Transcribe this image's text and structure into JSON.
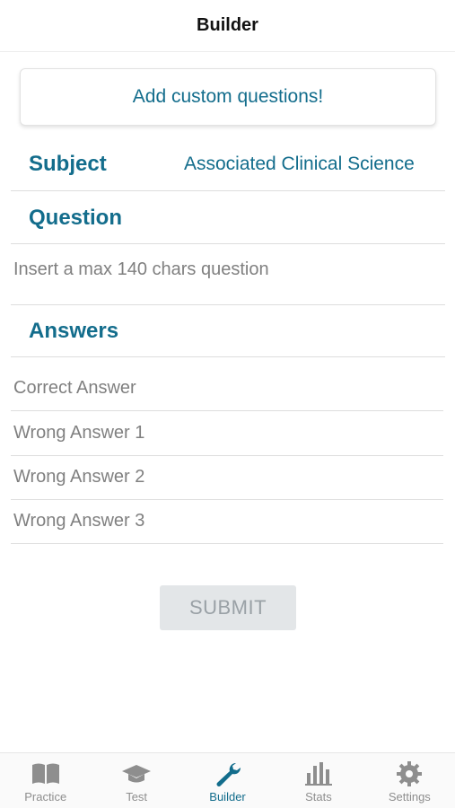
{
  "header": {
    "title": "Builder"
  },
  "custom_button": {
    "label": "Add custom questions!"
  },
  "subject": {
    "label": "Subject",
    "value": "Associated Clinical Science"
  },
  "question": {
    "label": "Question",
    "placeholder": "Insert a max 140 chars question"
  },
  "answers": {
    "label": "Answers",
    "fields": [
      {
        "placeholder": "Correct Answer"
      },
      {
        "placeholder": "Wrong Answer 1"
      },
      {
        "placeholder": "Wrong Answer 2"
      },
      {
        "placeholder": "Wrong Answer 3"
      }
    ]
  },
  "submit": {
    "label": "SUBMIT"
  },
  "tabbar": {
    "active": "Builder",
    "accent_color": "#136d8c",
    "inactive_color": "#8e8e8e",
    "tabs": [
      {
        "label": "Practice",
        "icon": "book-icon"
      },
      {
        "label": "Test",
        "icon": "graduation-cap-icon"
      },
      {
        "label": "Builder",
        "icon": "wrench-icon"
      },
      {
        "label": "Stats",
        "icon": "bar-chart-icon"
      },
      {
        "label": "Settings",
        "icon": "gear-icon"
      }
    ]
  }
}
